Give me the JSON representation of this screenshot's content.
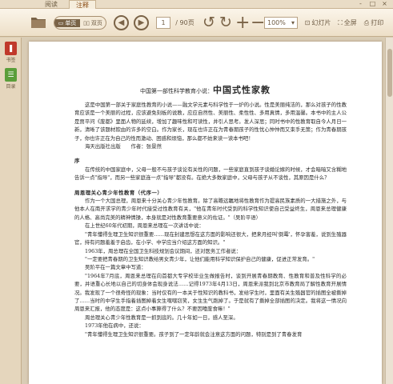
{
  "tabs": [
    "阅读",
    "注释"
  ],
  "window_controls": [
    "-",
    "□",
    "×"
  ],
  "toolbar": {
    "folder_icon": "folder-icon",
    "view_single": "单页",
    "view_double": "双页",
    "page_current": "1",
    "page_total": "/ 90页",
    "zoom_value": "100%",
    "slideshow": "幻灯片",
    "fullscreen": "全屏",
    "print": "打印"
  },
  "sidebar": {
    "items": [
      {
        "label": "书签",
        "icon": "bookmark-icon",
        "color": "#c0392b"
      },
      {
        "label": "目录",
        "icon": "toc-icon",
        "color": "#5a9e3a"
      }
    ]
  },
  "document": {
    "title_prefix": "中国第一部性科学教育小说：",
    "title_main": "中国式性家教",
    "para1": "这是中国第一部关于家庭性教育的小说——融文学元素与科学性于一炉的小说。性是美丽纯洁的，那么对孩子的性教育应该是一个美丽的过程，应该避免刻板的说教，应应自然性、美丽性、柔性性、多用真情，多用温馨。本书中的主人公是贾平问《废都》里面人物的延续，增加了趣味性和可读性，并引人思考。发人深思；同时书中的性教育取自今人月日一新，清晰了该题材欺由的许多的空白。作为家长，现在也许正在为青春期孩子的性忧心忡忡而又束手无策；作为青春期孩子，你也许正在为自己的性而激动、困惑和烦恼，那么都不妨来读一读本书吧！",
    "para1_publisher": "海天出版社出版　　作者：张景然",
    "preface_head": "序",
    "preface1": "在传统的中国家庭中，父母一般不与孩子谈论有关性的问题，一些家庭直到孩子谈婚论嫁的时候，才会暗暗又含糊地告诉一点\"指导\"，而另一些家庭连一点\"指导\"都没有。在绝大多数家庭中，父母与孩子从不谈性，其原因是什么？",
    "section_head": "周恩理关心青少年性教育（代序一）",
    "s1": "作为一个大国总理，周恩来十分关心青少年性教育。除了高瞻远瞩地将性教育作为提高民族素质的一大措施之外，与他本人在南开求学的青少年时代接受过性教育有关，\"他在青年时代受到的科学性知识使自己受益终生，周恩来总理健康的人格、高尚完美的精神情操，本身就是对性教育重要意义的佐证。\"（吴阶平语）",
    "s2": "在上世纪60年代初期，周恩来总理在一次讲话中说：",
    "s3": "\"青年懂得生理卫生知识很重要……现在封建思想在这方面的影响还很大，把来月经叫'倒霉'，怀孕害羞，说到生殖器官，持有问题羞羞于启齿，在小学、中学应当介绍这方面的知识。\"",
    "s4": "1963年，周总理在全国卫生科技规划会议期间，还对医务工作者说：",
    "s5": "\"一定要把青春期的卫生知识教给男女青少年，让他们能用科学知识保护自己的健康，促进正常发育。\"",
    "s6": "吴阶平在一篇文章中写道：",
    "s7": "\"1964年7月底，周恩来总理在向首都大专学校毕业生做报告时，谈到开展青春期教育、性教育和普及性科学的必要，并语重心长地以自己的切身体会现身说法……记得1973年4月13日，周恩来派我到北京市教育局了解性教育开展情况。我发现了一个很奇怪的现象：当时仅有的一本关于性知识的教科书，发给学生时，里面有关生殖器官的插图全被撕掉了……当时的中学生手指着插图掉着女生嘿嘿窃笑，女生生气跑掉了。于是就有了撕掉全部插图的决定。我将这一情况向周恩来汇报，他的态度是：这点小事算得了什么？不要因噎废食嘛！\"",
    "s8": "周总理关心青少年性教育是一抓到底的。几十年如一日，感人至深。",
    "s9": "1973年他在病中，还说：",
    "s10": "\"青年懂得生理卫生知识很重要。孩子到了一定年龄就会注意这方面的问题，特别是到了青春发育"
  }
}
